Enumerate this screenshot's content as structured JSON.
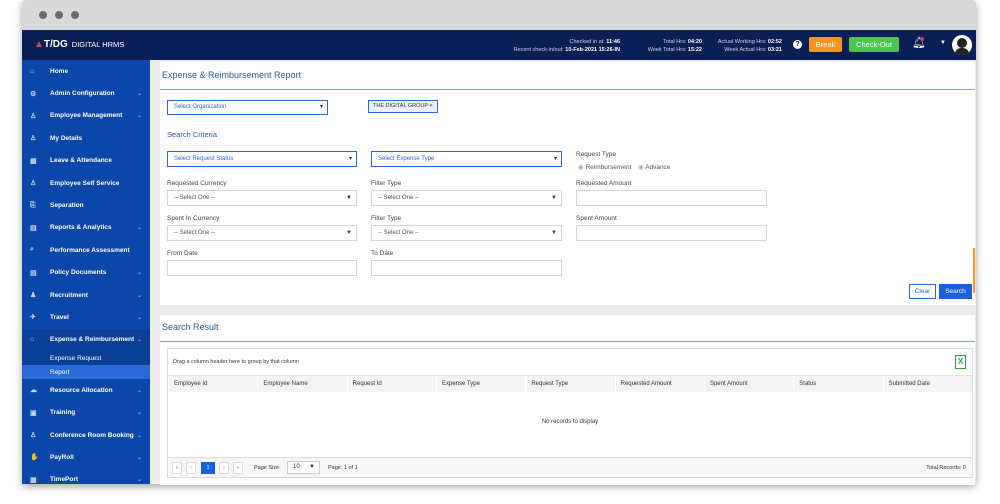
{
  "app": {
    "logo": "T/DG",
    "name": "DIGITAL HRMS"
  },
  "header": {
    "checked_in_label": "Checked in at:",
    "checked_in": "11:46",
    "recent_label": "Recent check-in/out:",
    "recent": "10-Feb-2021 15:26-IN",
    "total_label": "Total Hrs:",
    "total": "04:20",
    "week_total_label": "Week Total Hrs:",
    "week_total": "15:22",
    "actual_label": "Actual Working Hrs:",
    "actual": "02:52",
    "week_actual_label": "Week Actual Hrs:",
    "week_actual": "03:21",
    "help": "?",
    "break_label": "Break",
    "checkout_label": "Check-Out",
    "break_color": "#f7931e",
    "checkout_color": "#4cc552"
  },
  "sidebar": {
    "items": [
      {
        "label": "Home",
        "icon": "⌂"
      },
      {
        "label": "Admin Configuration",
        "icon": "⚙",
        "chev": "⌄"
      },
      {
        "label": "Employee Management",
        "icon": "♙",
        "chev": "⌄"
      },
      {
        "label": "My Details",
        "icon": "♙"
      },
      {
        "label": "Leave & Attendance",
        "icon": "▦"
      },
      {
        "label": "Employee Self Service",
        "icon": "♙"
      },
      {
        "label": "Separation",
        "icon": "⎘"
      },
      {
        "label": "Reports & Analytics",
        "icon": "▤",
        "chev": "⌄"
      },
      {
        "label": "Performance Assessment",
        "icon": "⌕"
      },
      {
        "label": "Policy Documents",
        "icon": "▤",
        "chev": "⌄"
      },
      {
        "label": "Recruitment",
        "icon": "♟",
        "chev": "⌄"
      },
      {
        "label": "Travel",
        "icon": "✈",
        "chev": "⌄"
      },
      {
        "label": "Expense & Reimbursement",
        "icon": "⌂",
        "chev": "⌄"
      }
    ],
    "sub": [
      {
        "label": "Expense Request"
      },
      {
        "label": "Report"
      }
    ],
    "items2": [
      {
        "label": "Resource Allocation",
        "icon": "☁",
        "chev": "⌄"
      },
      {
        "label": "Training",
        "icon": "▣",
        "chev": "⌄"
      },
      {
        "label": "Conference Room Booking",
        "icon": "♙",
        "chev": "⌄"
      },
      {
        "label": "PayRoll",
        "icon": "✋",
        "chev": "⌄"
      },
      {
        "label": "TimePort",
        "icon": "▦",
        "chev": "⌄"
      }
    ]
  },
  "report": {
    "title": "Expense & Reimbursement Report",
    "org_placeholder": "Select Organization",
    "org_tag": "THE DIGITAL GROUP",
    "org_tag_remove": "×",
    "criteria_title": "Search Criteria",
    "request_status": "Select Request Status",
    "expense_type": "Select Expense Type",
    "request_type_label": "Request Type",
    "radio1": "Reimbursement",
    "radio2": "Advance",
    "req_currency_label": "Requested Currency",
    "req_currency": "-- Select One --",
    "filter_type_label": "Filter Type",
    "filter_type": "-- Select One --",
    "req_amount_label": "Requested Amount",
    "spent_currency_label": "Spent In Currency",
    "spent_currency": "-- Select One --",
    "filter_type2_label": "Filter Type",
    "filter_type2": "-- Select One --",
    "spent_amount_label": "Spent Amount",
    "from_label": "From Date",
    "to_label": "To Date",
    "clear": "Clear",
    "search": "Search"
  },
  "results": {
    "title": "Search Result",
    "group_hint": "Drag a column header here to group by that column",
    "excel": "X",
    "columns": [
      "Employee Id",
      "Employee Name",
      "Request Id",
      "Expense Type",
      "Request Type",
      "Requested Amount",
      "Spent Amount",
      "Status",
      "Submitted Date"
    ],
    "empty": "No records to display",
    "pager": {
      "first": "«",
      "prev": "‹",
      "page": "1",
      "next": "›",
      "last": "»",
      "page_size_label": "Page Size:",
      "page_size": "10",
      "page_info": "Page: 1 of 1",
      "total": "Total Records: 0"
    }
  }
}
